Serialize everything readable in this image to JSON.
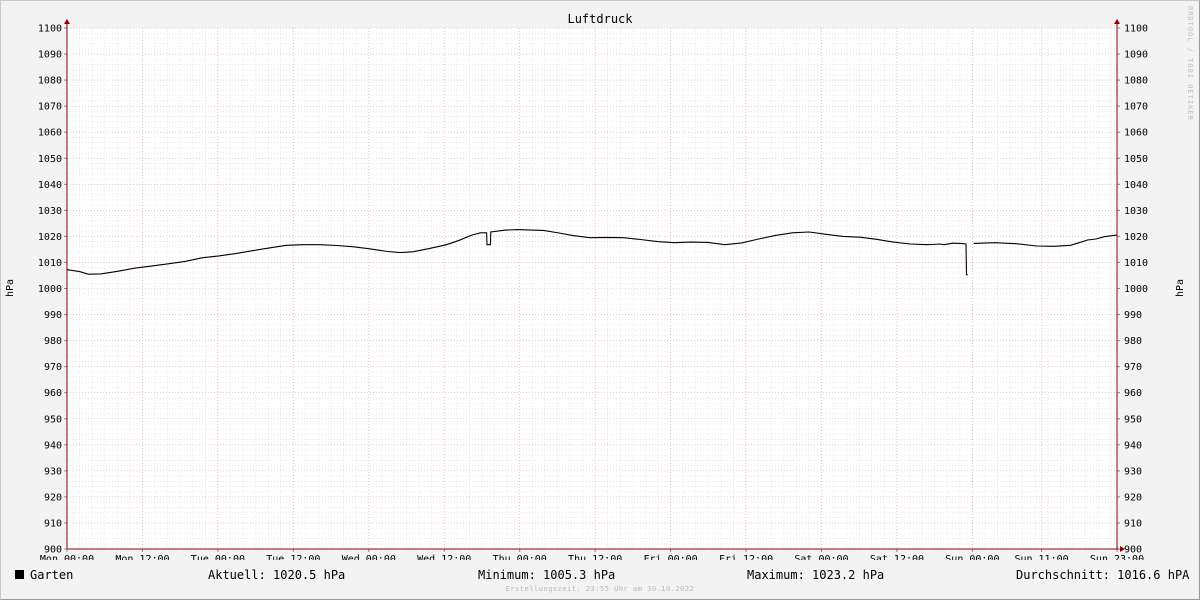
{
  "chart_data": {
    "type": "line",
    "title": "Luftdruck",
    "ylabel": "hPa",
    "ylim": [
      900,
      1100
    ],
    "y_ticks": [
      900,
      910,
      920,
      930,
      940,
      950,
      960,
      970,
      980,
      990,
      1000,
      1010,
      1020,
      1030,
      1040,
      1050,
      1060,
      1070,
      1080,
      1090,
      1100
    ],
    "x_ticks": [
      "Mon 00:00",
      "Mon 12:00",
      "Tue 00:00",
      "Tue 12:00",
      "Wed 00:00",
      "Wed 12:00",
      "Thu 00:00",
      "Thu 12:00",
      "Fri 00:00",
      "Fri 12:00",
      "Sat 00:00",
      "Sat 12:00",
      "Sun 00:00",
      "Sun 11:00",
      "Sun 23:00"
    ],
    "xlim_hours": [
      0,
      167
    ],
    "grid": true,
    "legend_position": "bottom",
    "series": [
      {
        "name": "Garten",
        "color": "#000000",
        "points": [
          [
            0,
            1007.2
          ],
          [
            3,
            1006.5
          ],
          [
            5,
            1005.5
          ],
          [
            8,
            1005.6
          ],
          [
            12,
            1006.6
          ],
          [
            16,
            1007.8
          ],
          [
            20,
            1008.6
          ],
          [
            24,
            1009.5
          ],
          [
            28,
            1010.4
          ],
          [
            32,
            1011.8
          ],
          [
            36,
            1012.5
          ],
          [
            40,
            1013.4
          ],
          [
            44,
            1014.5
          ],
          [
            48,
            1015.6
          ],
          [
            52,
            1016.6
          ],
          [
            56,
            1016.8
          ],
          [
            60,
            1016.8
          ],
          [
            64,
            1016.5
          ],
          [
            68,
            1016.0
          ],
          [
            72,
            1015.2
          ],
          [
            76,
            1014.2
          ],
          [
            79,
            1013.8
          ],
          [
            82,
            1014.1
          ],
          [
            86,
            1015.4
          ],
          [
            90,
            1016.8
          ],
          [
            93,
            1018.5
          ],
          [
            96,
            1020.5
          ],
          [
            98,
            1021.4
          ],
          [
            99.5,
            1021.4
          ],
          [
            99.6,
            1016.8
          ],
          [
            100.4,
            1016.8
          ],
          [
            100.5,
            1021.7
          ],
          [
            104,
            1022.4
          ],
          [
            107,
            1022.6
          ],
          [
            110,
            1022.4
          ],
          [
            113,
            1022.3
          ],
          [
            116,
            1021.5
          ],
          [
            120,
            1020.3
          ],
          [
            124,
            1019.5
          ],
          [
            128,
            1019.6
          ],
          [
            132,
            1019.5
          ],
          [
            136,
            1018.8
          ],
          [
            140,
            1018.0
          ],
          [
            144,
            1017.6
          ],
          [
            148,
            1017.8
          ],
          [
            152,
            1017.7
          ],
          [
            156,
            1016.8
          ],
          [
            160,
            1017.5
          ],
          [
            164,
            1019.0
          ],
          [
            168,
            1020.4
          ],
          [
            172,
            1021.4
          ],
          [
            176,
            1021.7
          ],
          [
            180,
            1020.8
          ],
          [
            184,
            1020.0
          ],
          [
            188,
            1019.7
          ],
          [
            192,
            1018.9
          ],
          [
            196,
            1017.8
          ],
          [
            200,
            1017.1
          ],
          [
            204,
            1016.8
          ],
          [
            205,
            1016.9
          ],
          [
            207,
            1017.1
          ],
          [
            208,
            1016.8
          ],
          [
            210,
            1017.4
          ],
          [
            212,
            1017.3
          ],
          [
            213.2,
            1017.1
          ],
          [
            213.3,
            1005.3
          ],
          [
            213.6,
            1005.3
          ],
          [
            213.8,
            null
          ],
          [
            215,
            1017.3
          ],
          [
            220,
            1017.6
          ],
          [
            225,
            1017.2
          ],
          [
            230,
            1016.3
          ],
          [
            234,
            1016.2
          ],
          [
            238,
            1016.6
          ],
          [
            240,
            1017.6
          ],
          [
            242,
            1018.6
          ],
          [
            244,
            1019.0
          ],
          [
            246,
            1019.9
          ],
          [
            248,
            1020.3
          ],
          [
            249,
            1020.5
          ]
        ]
      }
    ],
    "x_axis_note": "hours from Mon 00:00; scale follows tick labels (Sun 00:00 at 144, Sun 11:00 at 155, Sun 23:00 at 167)"
  },
  "legend": {
    "series_name": "Garten",
    "aktuell": "Aktuell: 1020.5 hPa",
    "minimum": "Minimum: 1005.3 hPa",
    "maximum": "Maximum: 1023.2 hPa",
    "durchschnitt": "Durchschnitt: 1016.6 hPA"
  },
  "footer": "Erstellungszeit: 23:55 Uhr am 30.10.2022",
  "watermark": "RRDTOOL / TOBI OETIKER"
}
